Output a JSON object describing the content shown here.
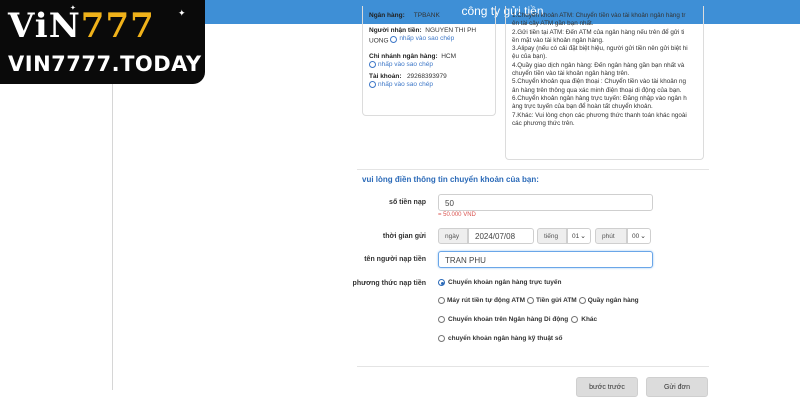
{
  "header": {
    "title": "công ty gửi tiền"
  },
  "logo": {
    "main_v": "V",
    "main_i": "i",
    "main_n": "N",
    "main_777": "777",
    "sub": "VIN7777.TODAY"
  },
  "bank": {
    "bank_label": "Ngân hàng:",
    "bank_value": "TPBANK",
    "recipient_label": "Người nhận tiền:",
    "recipient_value": "NGUYEN THI PH",
    "recipient_value_2": "UONG",
    "branch_label": "Chi nhánh ngân hàng:",
    "branch_value": "HCM",
    "account_label": "Tài khoản:",
    "account_value": "29268393979",
    "copy_label": "nhấp vào sao chép"
  },
  "methods_text": [
    "1.Chuyển khoản ATM: Chuyển tiền vào tài khoản ngân hàng tr",
    "ên tài cây ATM gần bạn nhất.",
    "2.Gửi tiền tại ATM: Đến ATM của ngân hàng nếu trên để gửi ti",
    "ền mặt vào tài khoản ngân hàng.",
    "3.Alipay (nếu có cải đặt biệt hiệu, người gửi tiền nên gửi biệt hi",
    "ệu của bạn).",
    "4.Quầy giao dịch ngân hàng: Đến ngân hàng gần bạn nhất và",
    "chuyển tiền vào tài khoản ngân hàng trên.",
    "5.Chuyển khoản qua điện thoại : Chuyển tiền vào tài khoản ng",
    "ân hàng trên thông qua xác minh điện thoại di động của bạn.",
    "6.Chuyển khoản ngân hàng trực tuyến: Đăng nhập vào ngân h",
    "àng trực tuyến của bạn để hoàn tất chuyển khoản.",
    "7.Khác: Vui lòng chọn các phương thức thanh toán khác ngoài",
    "các phương thức trên."
  ],
  "form": {
    "heading": "vui lòng điền thông tin chuyển khoản của bạn:",
    "amount_label": "số tiền nạp",
    "amount_value": "50",
    "amount_hint": "= 50.000 VND",
    "time_label": "thời gian gửi",
    "date_addon": "ngày",
    "date_value": "2024/07/08",
    "hour_addon": "tiếng",
    "hour_value": "01",
    "minute_addon": "phút",
    "minute_value": "00",
    "name_label": "tên người nạp tiền",
    "name_value": "TRAN PHU",
    "method_label": "phương thức nạp tiền",
    "options": {
      "online_transfer": "Chuyển khoản ngân hàng trực tuyến",
      "atm_withdraw": "Máy rút tiền tự động ATM",
      "atm_deposit": "Tiền gửi ATM",
      "bank_counter": "Quầy ngân hàng",
      "mobile_transfer": "Chuyển khoản trên Ngân hàng Di động",
      "other": "Khác",
      "digital_transfer": "chuyển khoản ngân hàng kỹ thuật số"
    }
  },
  "buttons": {
    "back": "bước trước",
    "submit": "Gửi đơn"
  },
  "colors": {
    "header": "#3e8fd6",
    "accent": "#2b6ab8",
    "logo_gold": "#f0b21a",
    "hint_red": "#d9534f"
  }
}
